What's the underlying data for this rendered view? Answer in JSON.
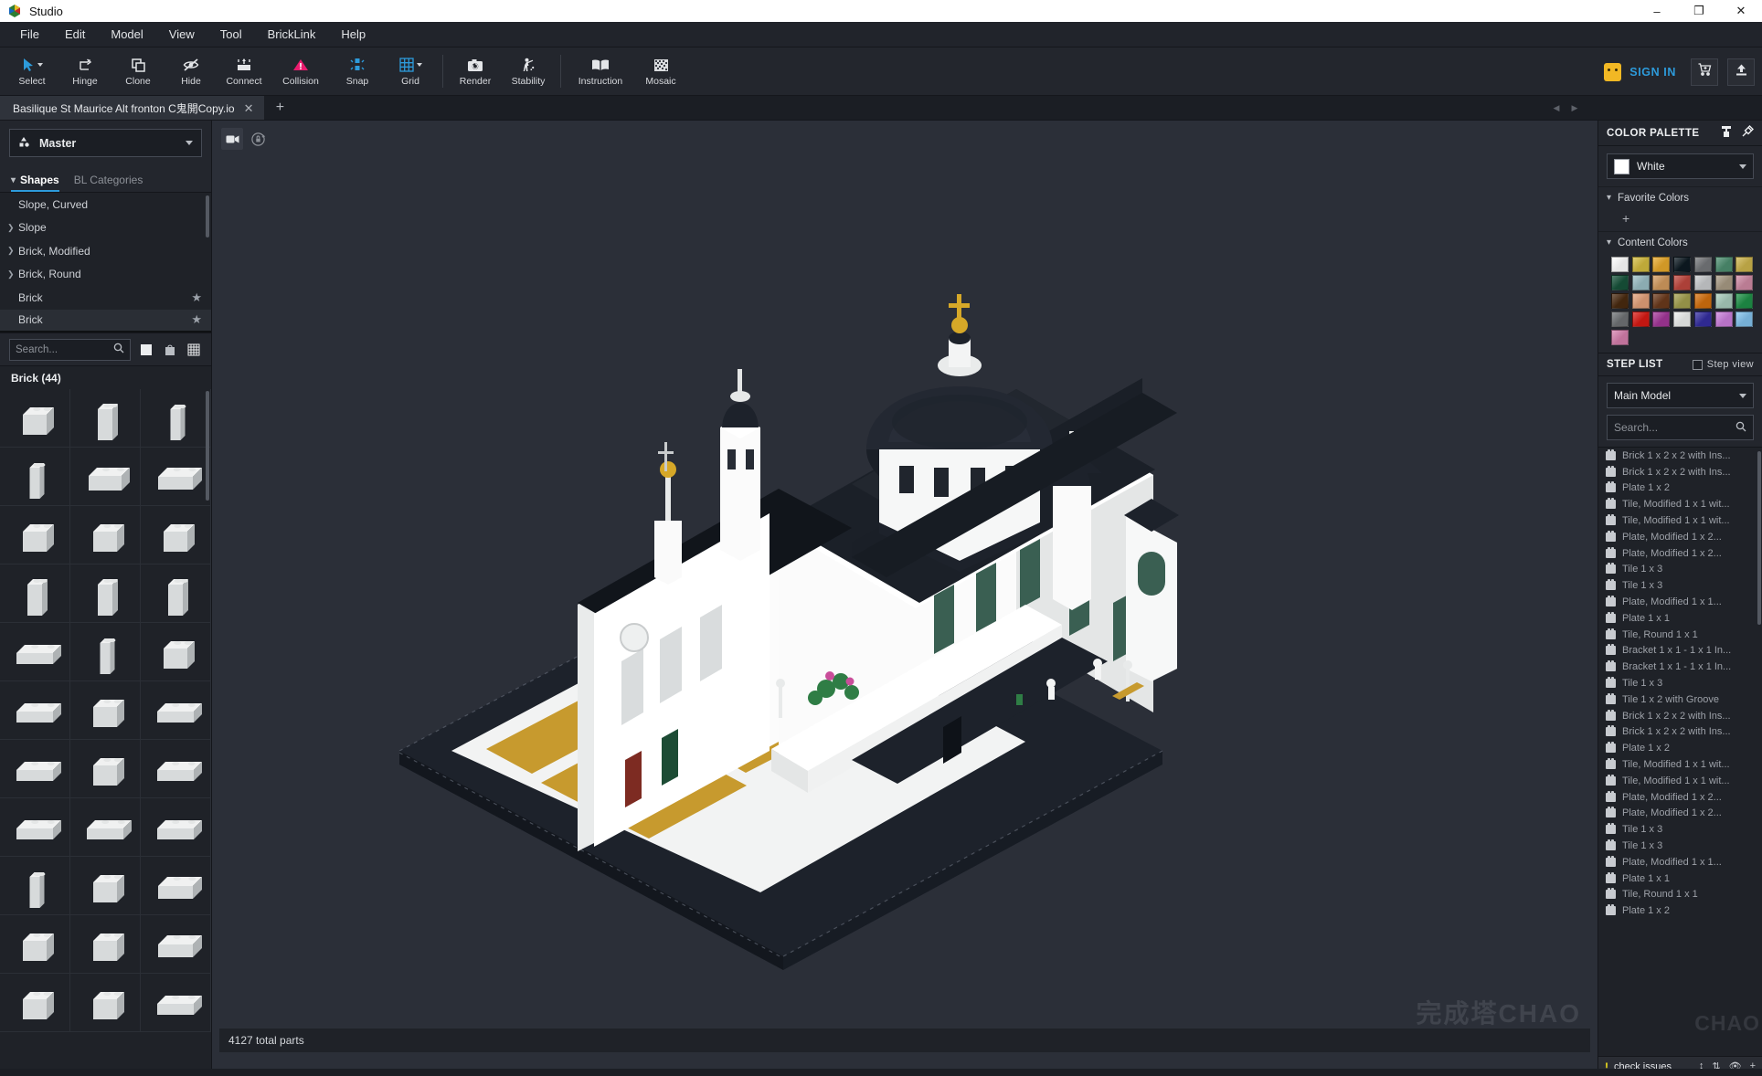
{
  "window": {
    "app_title": "Studio",
    "app_icon": "studio-logo-icon",
    "minimize": "–",
    "maximize": "❐",
    "close": "✕"
  },
  "menubar": {
    "items": [
      {
        "label": "File"
      },
      {
        "label": "Edit"
      },
      {
        "label": "Model"
      },
      {
        "label": "View"
      },
      {
        "label": "Tool"
      },
      {
        "label": "BrickLink"
      },
      {
        "label": "Help"
      }
    ]
  },
  "toolbar": {
    "tools": [
      {
        "label": "Select",
        "icon": "cursor-arrow-icon",
        "has_caret": true
      },
      {
        "label": "Hinge",
        "icon": "hinge-rotate-icon",
        "has_caret": false
      },
      {
        "label": "Clone",
        "icon": "clone-copy-icon",
        "has_caret": false
      },
      {
        "label": "Hide",
        "icon": "eye-slash-icon",
        "has_caret": false
      },
      {
        "label": "Connect",
        "icon": "connect-icon",
        "has_caret": false
      },
      {
        "label": "Collision",
        "icon": "warning-triangle-icon",
        "has_caret": false
      },
      {
        "label": "Snap",
        "icon": "snap-icon",
        "has_caret": false
      },
      {
        "label": "Grid",
        "icon": "grid-icon",
        "has_caret": true
      },
      {
        "label": "Render",
        "icon": "camera-icon",
        "has_caret": false
      },
      {
        "label": "Stability",
        "icon": "stability-figure-icon",
        "has_caret": false
      },
      {
        "label": "Instruction",
        "icon": "book-icon",
        "has_caret": false
      },
      {
        "label": "Mosaic",
        "icon": "mosaic-icon",
        "has_caret": false
      }
    ],
    "sign_in_label": "SIGN IN",
    "cart_icon": "cart-icon",
    "upload_icon": "upload-icon"
  },
  "tabstrip": {
    "tabs": [
      {
        "title": "Basilique St Maurice Alt fronton C鬼開Copy.io",
        "active": true
      }
    ],
    "add_label": "+",
    "prev_arrow": "◀",
    "next_arrow": "▶"
  },
  "left_panel": {
    "submodel": {
      "value": "Master",
      "icon": "submodel-icon"
    },
    "tabs": [
      {
        "label": "Shapes",
        "active": true
      },
      {
        "label": "BL Categories",
        "active": false
      }
    ],
    "categories": [
      {
        "label": "Brick",
        "expandable": false,
        "star": true,
        "selected": true
      },
      {
        "label": "Brick",
        "expandable": false,
        "star": true,
        "selected": false
      },
      {
        "label": "Brick, Round",
        "expandable": true,
        "star": false,
        "selected": false
      },
      {
        "label": "Brick, Modified",
        "expandable": true,
        "star": false,
        "selected": false
      },
      {
        "label": "Slope",
        "expandable": true,
        "star": false,
        "selected": false
      },
      {
        "label": "Slope, Curved",
        "expandable": false,
        "star": false,
        "selected": false
      }
    ],
    "search_placeholder": "Search...",
    "view_modes": [
      "list-view-icon",
      "bag-view-icon",
      "grid-view-icon"
    ],
    "parts_header": "Brick (44)",
    "part_cells": 33
  },
  "viewport": {
    "camera_icon": "camera-view-icon",
    "orbit_lock_icon": "orbit-lock-icon",
    "status_text": "4127 total parts",
    "watermark": "完成塔CHAO"
  },
  "right_panel": {
    "color_palette": {
      "title": "COLOR PALETTE",
      "header_icons": [
        "paint-roller-icon",
        "eyedropper-icon"
      ],
      "selected_color": {
        "name": "White",
        "hex": "#ffffff"
      },
      "favorite_colors": {
        "label": "Favorite Colors",
        "add_label": "+"
      },
      "content_colors": {
        "label": "Content Colors",
        "swatches": [
          "#ffffff",
          "#d4bc3f",
          "#e8a92b",
          "#0d1a22",
          "#75777a",
          "#4e8f71",
          "#cdb44c",
          "#17523a",
          "#9bbec5",
          "#d39b5f",
          "#c0473e",
          "#c9ccce",
          "#a89b85",
          "#cf8aa4",
          "#4a2a10",
          "#e3a079",
          "#6b3a1c",
          "#a3a04f",
          "#d4700e",
          "#a9cdbd",
          "#1f9148",
          "#6f7275",
          "#d81a14",
          "#a4379a",
          "#eef0ef",
          "#342ea0",
          "#cc7fdd",
          "#83c3ed",
          "#d67fad"
        ]
      }
    },
    "step_list": {
      "title": "STEP LIST",
      "step_view_label": "Step view",
      "step_view_checked": false,
      "model_selector": "Main Model",
      "search_placeholder": "Search...",
      "items": [
        "Brick 1 x 2 x 2 with Ins...",
        "Brick 1 x 2 x 2 with Ins...",
        "Plate 1 x 2",
        "Tile, Modified 1 x 1 wit...",
        "Tile, Modified 1 x 1 wit...",
        "Plate, Modified 1 x 2...",
        "Plate, Modified 1 x 2...",
        "Tile 1 x 3",
        "Tile 1 x 3",
        "Plate, Modified 1 x 1...",
        "Plate 1 x 1",
        "Tile, Round 1 x 1",
        "Bracket 1 x 1 - 1 x 1 In...",
        "Bracket 1 x 1 - 1 x 1 In...",
        "Tile 1 x 3",
        "Tile 1 x 2 with Groove",
        "Brick 1 x 2 x 2 with Ins...",
        "Brick 1 x 2 x 2 with Ins...",
        "Plate 1 x 2",
        "Tile, Modified 1 x 1 wit...",
        "Tile, Modified 1 x 1 wit...",
        "Plate, Modified 1 x 2...",
        "Plate, Modified 1 x 2...",
        "Tile 1 x 3",
        "Tile 1 x 3",
        "Plate, Modified 1 x 1...",
        "Plate 1 x 1",
        "Tile, Round 1 x 1",
        "Plate 1 x 2"
      ]
    },
    "issue_bar": {
      "label": "check issues",
      "icons": [
        "collapse-icon",
        "expand-icon",
        "eye-slash-icon",
        "plus-icon"
      ]
    },
    "watermark": "CHAO"
  }
}
